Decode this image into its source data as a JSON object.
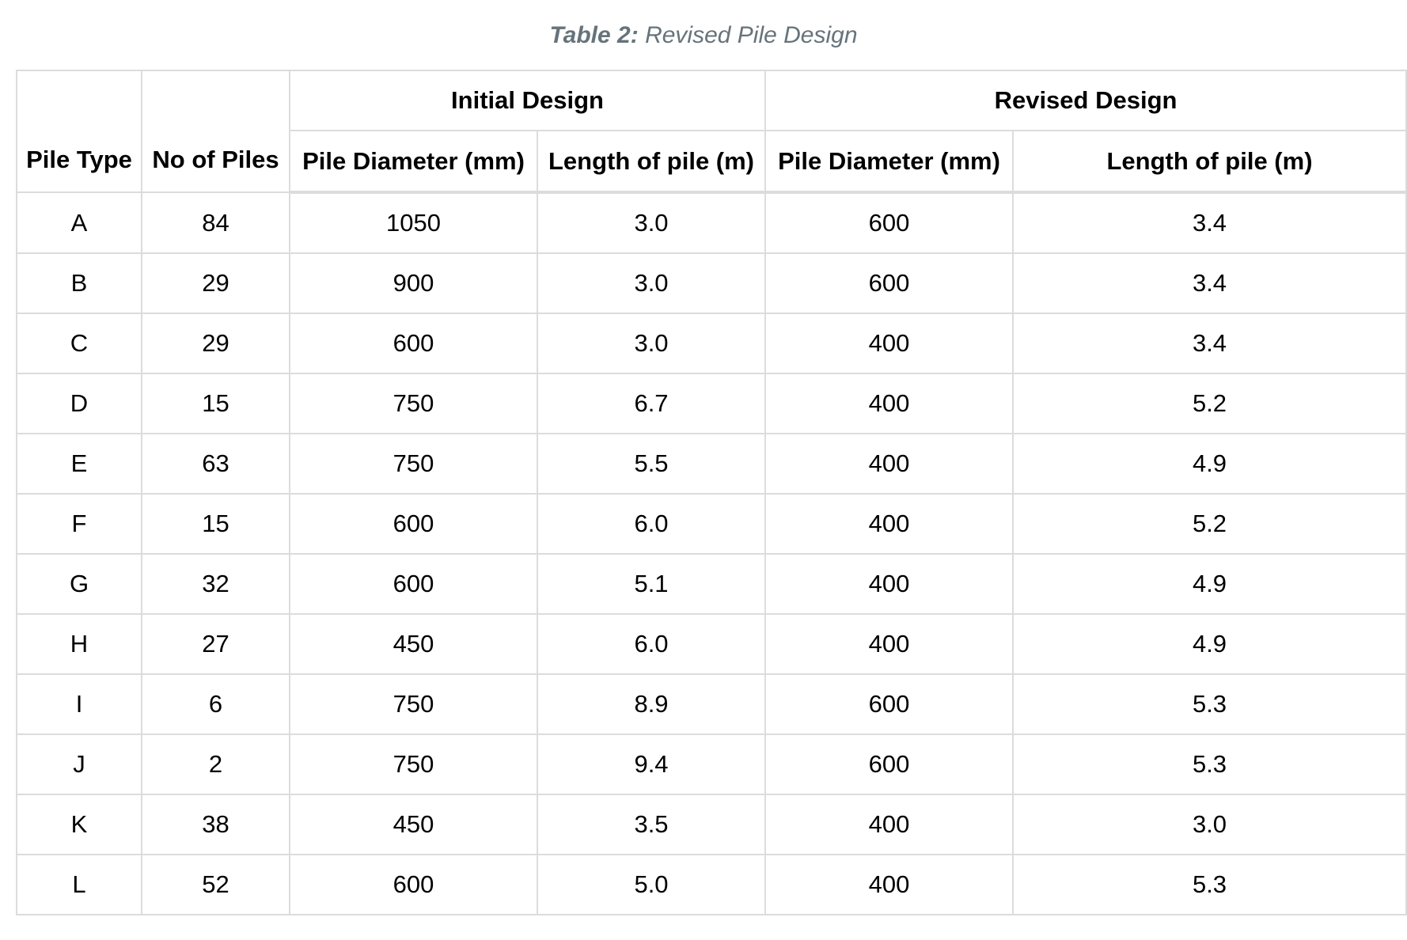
{
  "caption": {
    "label": "Table 2:",
    "text": "Revised Pile Design"
  },
  "table": {
    "header": {
      "pile_type": "Pile Type",
      "no_of_piles": "No of Piles",
      "group_initial": "Initial Design",
      "group_revised": "Revised Design",
      "initial_diameter": "Pile Diameter (mm)",
      "initial_length": "Length of pile (m)",
      "revised_diameter": "Pile Diameter (mm)",
      "revised_length": "Length of pile (m)"
    },
    "rows": [
      {
        "type": "A",
        "count": "84",
        "init_dia": "1050",
        "init_len": "3.0",
        "rev_dia": "600",
        "rev_len": "3.4"
      },
      {
        "type": "B",
        "count": "29",
        "init_dia": "900",
        "init_len": "3.0",
        "rev_dia": "600",
        "rev_len": "3.4"
      },
      {
        "type": "C",
        "count": "29",
        "init_dia": "600",
        "init_len": "3.0",
        "rev_dia": "400",
        "rev_len": "3.4"
      },
      {
        "type": "D",
        "count": "15",
        "init_dia": "750",
        "init_len": "6.7",
        "rev_dia": "400",
        "rev_len": "5.2"
      },
      {
        "type": "E",
        "count": "63",
        "init_dia": "750",
        "init_len": "5.5",
        "rev_dia": "400",
        "rev_len": "4.9"
      },
      {
        "type": "F",
        "count": "15",
        "init_dia": "600",
        "init_len": "6.0",
        "rev_dia": "400",
        "rev_len": "5.2"
      },
      {
        "type": "G",
        "count": "32",
        "init_dia": "600",
        "init_len": "5.1",
        "rev_dia": "400",
        "rev_len": "4.9"
      },
      {
        "type": "H",
        "count": "27",
        "init_dia": "450",
        "init_len": "6.0",
        "rev_dia": "400",
        "rev_len": "4.9"
      },
      {
        "type": "I",
        "count": "6",
        "init_dia": "750",
        "init_len": "8.9",
        "rev_dia": "600",
        "rev_len": "5.3"
      },
      {
        "type": "J",
        "count": "2",
        "init_dia": "750",
        "init_len": "9.4",
        "rev_dia": "600",
        "rev_len": "5.3"
      },
      {
        "type": "K",
        "count": "38",
        "init_dia": "450",
        "init_len": "3.5",
        "rev_dia": "400",
        "rev_len": "3.0"
      },
      {
        "type": "L",
        "count": "52",
        "init_dia": "600",
        "init_len": "5.0",
        "rev_dia": "400",
        "rev_len": "5.3"
      }
    ]
  },
  "colors": {
    "caption": "#66737a",
    "border": "#dcdcdc",
    "text": "#000000"
  }
}
